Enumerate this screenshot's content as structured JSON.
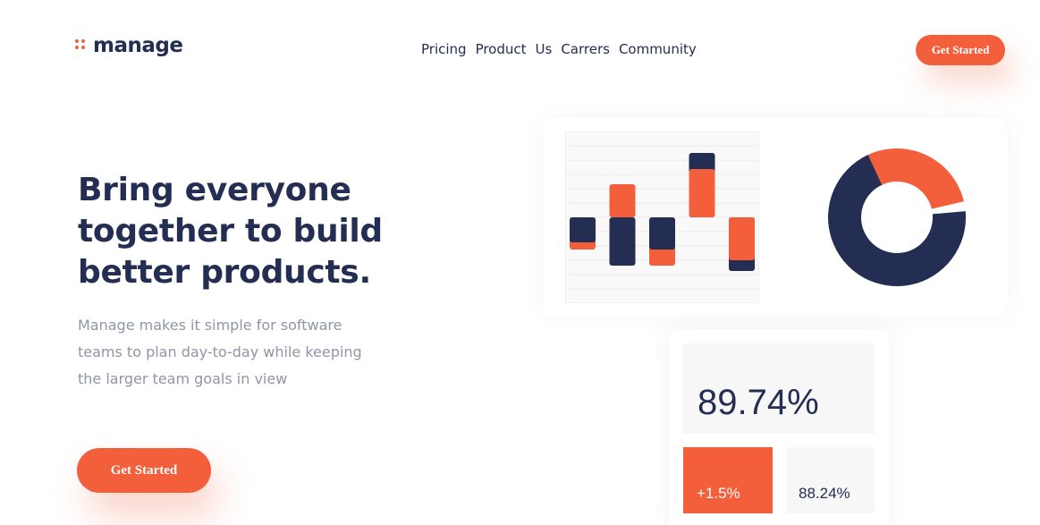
{
  "brand": {
    "name": "manage",
    "accent": "#f25f3a",
    "navy": "#242d52"
  },
  "nav": {
    "items": [
      "Pricing",
      "Product",
      "Us",
      "Carrers",
      "Community"
    ]
  },
  "header": {
    "cta_label": "Get Started"
  },
  "hero": {
    "title": "Bring everyone together to build better products.",
    "text": "Manage makes it simple for software teams to plan day-to-day while keeping the larger team goals in view",
    "cta_label": "Get Started"
  },
  "chart_data": [
    {
      "type": "bar",
      "categories": [
        "1",
        "2",
        "3",
        "4",
        "5"
      ],
      "series": [
        {
          "values": [
            28,
            54,
            36,
            72,
            60
          ],
          "color": "#242d52"
        },
        {
          "values": [
            36,
            37,
            54,
            54,
            48
          ],
          "color": "#f25f3a"
        }
      ]
    },
    {
      "type": "pie",
      "slices": [
        {
          "value": 70,
          "color": "#242d52"
        },
        {
          "value": 30,
          "color": "#f25f3a"
        }
      ]
    }
  ],
  "stats": {
    "main_value": "89.74%",
    "change_value": "+1.5%",
    "secondary_value": "88.24%"
  }
}
